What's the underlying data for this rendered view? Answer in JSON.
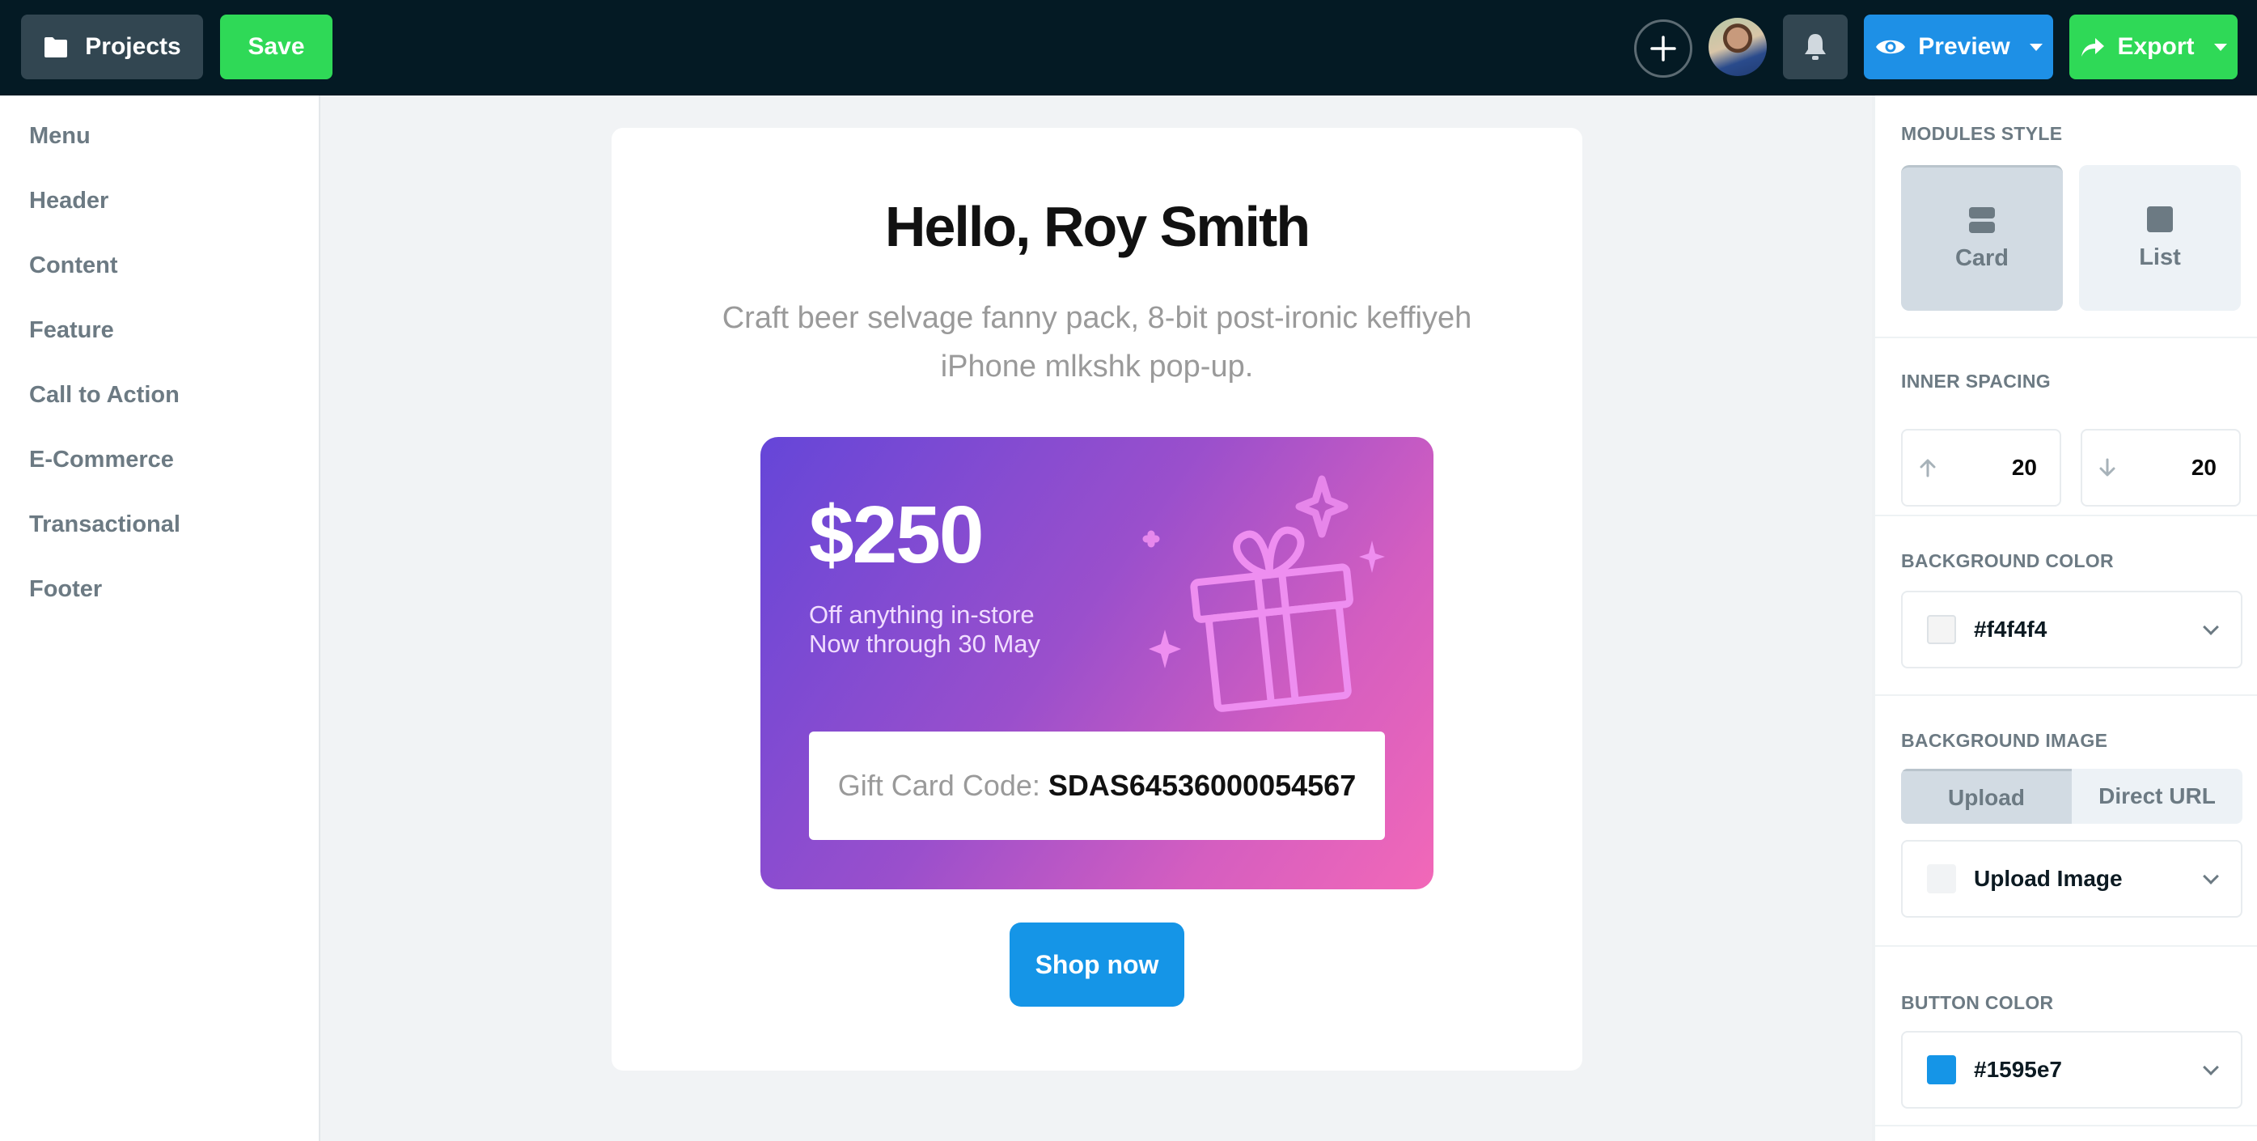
{
  "topbar": {
    "projects_label": "Projects",
    "save_label": "Save",
    "preview_label": "Preview",
    "export_label": "Export",
    "icons": {
      "projects": "folder-icon",
      "add": "plus-icon",
      "notifications": "bell-icon",
      "preview": "eye-icon",
      "export": "share-arrow-icon"
    }
  },
  "sidebar": {
    "items": [
      {
        "label": "Menu"
      },
      {
        "label": "Header"
      },
      {
        "label": "Content"
      },
      {
        "label": "Feature"
      },
      {
        "label": "Call to Action"
      },
      {
        "label": "E-Commerce"
      },
      {
        "label": "Transactional"
      },
      {
        "label": "Footer"
      }
    ]
  },
  "email": {
    "title": "Hello, Roy Smith",
    "subtitle": "Craft beer selvage fanny pack, 8-bit post-ironic keffiyeh iPhone mlkshk pop-up.",
    "gift_card": {
      "amount": "$250",
      "line1": "Off anything in-store",
      "line2": "Now through 30 May",
      "code_label": "Gift Card Code:",
      "code_value": "SDAS64536000054567",
      "gradient_start": "#6546d8",
      "gradient_end": "#f268b8"
    },
    "cta_label": "Shop now"
  },
  "panel": {
    "modules_style": {
      "label": "MODULES STYLE",
      "options": [
        {
          "label": "Card",
          "selected": true
        },
        {
          "label": "List",
          "selected": false
        }
      ]
    },
    "inner_spacing": {
      "label": "INNER SPACING",
      "top": "20",
      "bottom": "20"
    },
    "background_color": {
      "label": "BACKGROUND COLOR",
      "value": "#f4f4f4"
    },
    "background_image": {
      "label": "BACKGROUND IMAGE",
      "tabs": [
        {
          "label": "Upload",
          "selected": true
        },
        {
          "label": "Direct URL",
          "selected": false
        }
      ],
      "select_label": "Upload Image"
    },
    "button_color": {
      "label": "BUTTON COLOR",
      "value": "#1595e7"
    }
  },
  "colors": {
    "topbar_bg": "#041a24",
    "save_green": "#2fd957",
    "preview_blue": "#1e90e6",
    "cta_blue": "#1595e7"
  }
}
